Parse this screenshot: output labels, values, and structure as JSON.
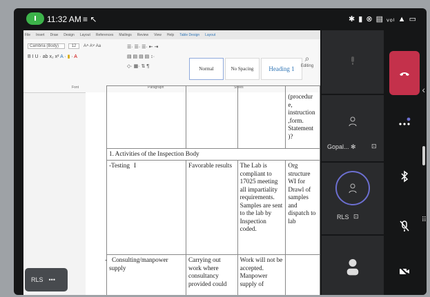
{
  "status_bar": {
    "time": "11:32 AM",
    "left_icons": "≡ ↖",
    "right_icons": "✱ ▮ ⊗ ▤ ᵥₒₗ ▲ ▭"
  },
  "ribbon": {
    "menu_tabs": [
      "File",
      "Insert",
      "Draw",
      "Design",
      "Layout",
      "References",
      "Mailings",
      "Review",
      "View",
      "Help",
      "Table Design",
      "Layout"
    ],
    "font_name": "Cambria (Body)",
    "font_size": "12",
    "styles": [
      "Normal",
      "No Spacing",
      "Heading 1"
    ],
    "editing_label": "Editing",
    "groups": [
      "Font",
      "Paragraph",
      "Styles"
    ]
  },
  "document": {
    "top_fragment": [
      "(procedur",
      "e,",
      "instruction",
      ",form.",
      "Statement",
      ")?"
    ],
    "section_title": "1. Activities of the Inspection Body",
    "rows": [
      {
        "c1": "-Testing",
        "c2": "Favorable results",
        "c3": "The Lab is compliant to 17025 meeting all impartiality requirements. Samples are sent to the lab by Inspection coded.",
        "c4": "Org structure WI for Drawl of samples and dispatch to lab"
      },
      {
        "c1": "Consulting/manpower supply",
        "c2": "Carrying out work where consultancy provided could",
        "c3": "Work will not be accepted. Manpower supply of",
        "c4": ""
      }
    ]
  },
  "presenter_chip": {
    "label": "RLS",
    "more": "•••"
  },
  "participants": [
    {
      "name": "",
      "icon": "mic-off-icon"
    },
    {
      "name": "Gopal... ✻",
      "icon": "person-icon"
    },
    {
      "name": "RLS",
      "icon": "person-icon"
    },
    {
      "name": "",
      "icon": "person-icon"
    }
  ],
  "controls": [
    "end-call",
    "more",
    "bluetooth",
    "mute",
    "video-off"
  ],
  "colors": {
    "end_call": "#c4314b",
    "call_pill": "#3cb34a",
    "speaker_ring": "#6c6fd0",
    "heading_blue": "#2e74b5"
  }
}
